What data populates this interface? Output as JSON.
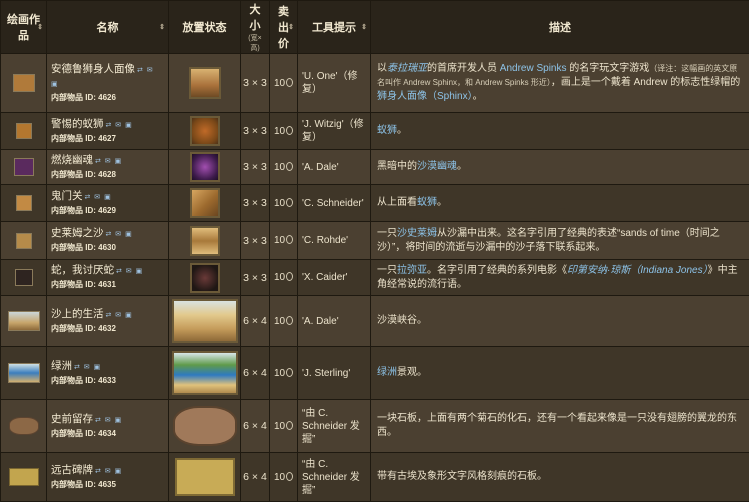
{
  "headers": {
    "art": "绘画作品",
    "name": "名称",
    "placed": "放置状态",
    "size": "大小",
    "size_sub": "(宽×高)",
    "price": "卖出价",
    "hint": "工具提示",
    "desc": "描述"
  },
  "colors": {
    "header_bg": "#2a241a",
    "row_odd": "#4b4031",
    "row_even": "#3f3628",
    "link": "#8dc3e8"
  },
  "rows": [
    {
      "name": "安德鲁狮身人面像",
      "tags": "⇄ ✉ ▣",
      "id_label": "内部物品 ID:",
      "id": "4626",
      "size": "3 × 3",
      "price": "10",
      "hint": "'U. One'（修复）"
    },
    {
      "name": "警惕的蚁狮",
      "tags": "⇄ ✉ ▣",
      "id_label": "内部物品 ID:",
      "id": "4627",
      "size": "3 × 3",
      "price": "10",
      "hint": "'J. Witzig'（修复）"
    },
    {
      "name": "燃烧幽魂",
      "tags": "⇄ ✉ ▣",
      "id_label": "内部物品 ID:",
      "id": "4628",
      "size": "3 × 3",
      "price": "10",
      "hint": "'A. Dale'"
    },
    {
      "name": "鬼门关",
      "tags": "⇄ ✉ ▣",
      "id_label": "内部物品 ID:",
      "id": "4629",
      "size": "3 × 3",
      "price": "10",
      "hint": "'C. Schneider'"
    },
    {
      "name": "史莱姆之沙",
      "tags": "⇄ ✉ ▣",
      "id_label": "内部物品 ID:",
      "id": "4630",
      "size": "3 × 3",
      "price": "10",
      "hint": "'C. Rohde'"
    },
    {
      "name": "蛇，我讨厌蛇",
      "tags": "⇄ ✉ ▣",
      "id_label": "内部物品 ID:",
      "id": "4631",
      "size": "3 × 3",
      "price": "10",
      "hint": "'X. Caider'"
    },
    {
      "name": "沙上的生活",
      "tags": "⇄ ✉ ▣",
      "id_label": "内部物品 ID:",
      "id": "4632",
      "size": "6 × 4",
      "price": "10",
      "hint": "'A. Dale'"
    },
    {
      "name": "绿洲",
      "tags": "⇄ ✉ ▣",
      "id_label": "内部物品 ID:",
      "id": "4633",
      "size": "6 × 4",
      "price": "10",
      "hint": "'J. Sterling'"
    },
    {
      "name": "史前留存",
      "tags": "⇄ ✉ ▣",
      "id_label": "内部物品 ID:",
      "id": "4634",
      "size": "6 × 4",
      "price": "10",
      "hint": "“由 C. Schneider 发掘”"
    },
    {
      "name": "远古碑牌",
      "tags": "⇄ ✉ ▣",
      "id_label": "内部物品 ID:",
      "id": "4635",
      "size": "6 × 4",
      "price": "10",
      "hint": "“由 C. Schneider 发掘”"
    }
  ],
  "desc": {
    "r0": {
      "a": "以",
      "b": "泰拉瑞亚",
      "c": "的首席开发人员 ",
      "d": "Andrew Spinks",
      "e": " 的名字玩文字游戏",
      "f": "（译注：这幅画的英文原名叫作 Andrew Sphinx，和 Andrew Spinks 形近）",
      "g": "，画上是一个戴着 Andrew 的标志性绿帽的",
      "h": "狮身人面像（Sphinx）",
      "i": "。"
    },
    "r1": {
      "a": "蚁狮",
      "b": "。"
    },
    "r2": {
      "a": "黑暗中的",
      "b": "沙漠幽魂",
      "c": "。"
    },
    "r3": {
      "a": "从上面看",
      "b": "蚁狮",
      "c": "。"
    },
    "r4": {
      "a": "一只",
      "b": "沙史莱姆",
      "c": "从沙漏中出来。这名字引用了经典的表述“sands of time（时间之沙）”，将时间的流逝与沙漏中的沙子落下联系起来。"
    },
    "r5": {
      "a": "一只",
      "b": "拉弥亚",
      "c": "。名字引用了经典的系列电影《",
      "d": "印第安纳·琼斯（Indiana Jones）",
      "e": "》中主角经常说的流行语。"
    },
    "r6": {
      "a": "沙漠峡谷。"
    },
    "r7": {
      "a": "绿洲",
      "b": "景观。"
    },
    "r8": {
      "a": "一块石板，上面有两个菊石的化石，还有一个看起来像是一只没有翅膀的翼龙的东西。"
    },
    "r9": {
      "a": "带有古埃及象形文字风格刻痕的石板。"
    }
  }
}
